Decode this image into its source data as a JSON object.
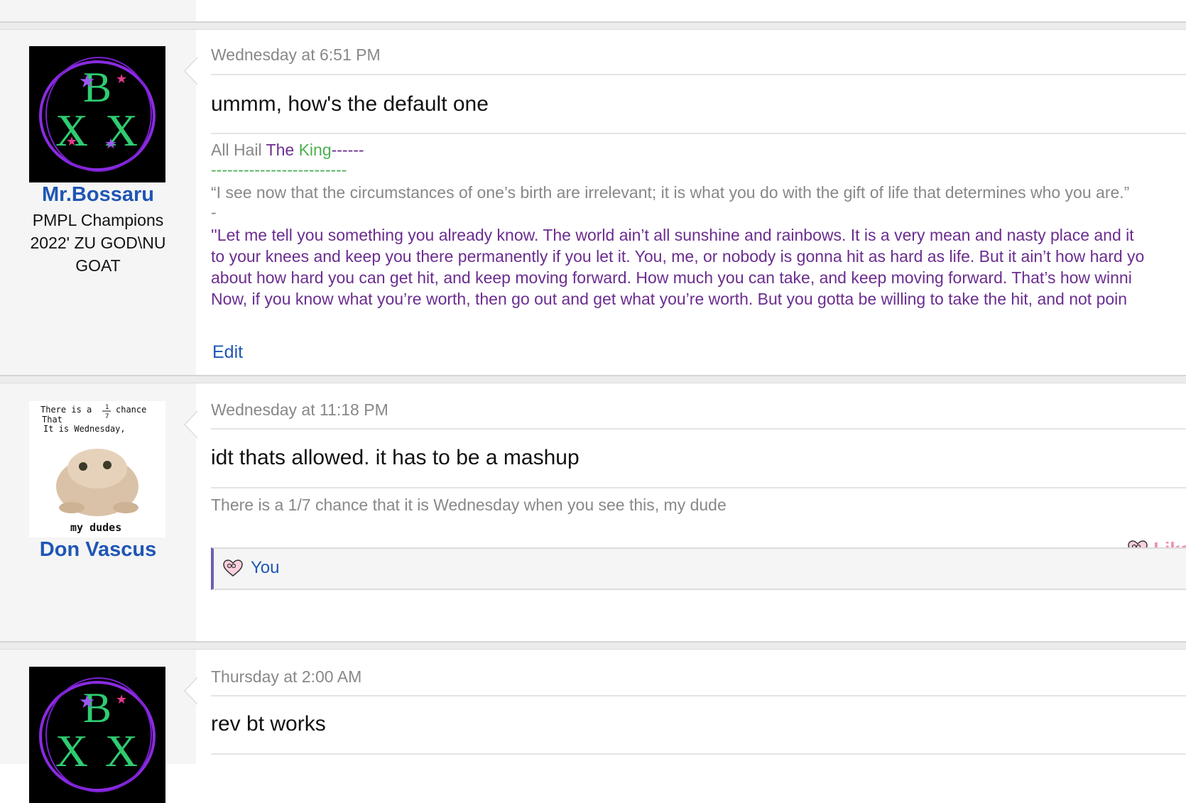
{
  "top_partial_text": "Mr.Bossaru",
  "posts": [
    {
      "author": "Mr.Bossaru",
      "user_title": "PMPL Champions 2022' ZU GOD\\NU GOAT",
      "avatar_icon": "bx-logo-avatar",
      "date": "Wednesday at 6:51 PM",
      "message": "ummm, how's the default one",
      "signature": {
        "hail_prefix": "All Hail ",
        "hail_the": "The",
        "hail_king": " King",
        "hail_dashes": "------",
        "dash_line": "-------------------------",
        "quote1": "“I see now that the circumstances of one’s birth are irrelevant; it is what you do with the gift of life that determines who you are.”",
        "quote1_dash": "-",
        "quote2_line1": "''Let me tell you something you already know. The world ain’t all sunshine and rainbows. It is a very mean and nasty place and it",
        "quote2_line2": "to your knees and keep you there permanently if you let it. You, me, or nobody is gonna hit as hard as life. But it ain’t how hard yo",
        "quote2_line3": "about how hard you can get hit, and keep moving forward. How much you can take, and keep moving forward. That’s how winni",
        "quote2_line4": "Now, if you know what you’re worth, then go out and get what you’re worth. But you gotta be willing to take the hit, and not poin"
      },
      "action_edit": "Edit"
    },
    {
      "author": "Don Vascus",
      "avatar_icon": "wednesday-frog-avatar",
      "avatar_text_line1": "There is a",
      "avatar_fraction_num": "1",
      "avatar_fraction_den": "7",
      "avatar_text_chance": "chance",
      "avatar_text_line2": "That",
      "avatar_text_line3": "It is Wednesday,",
      "avatar_text_bottom": "my dudes",
      "date": "Wednesday at 11:18 PM",
      "message": "idt thats allowed. it has to be a mashup",
      "signature_text": "There is a 1/7 chance that it is Wednesday when you see this, my dude",
      "like_label": "Like",
      "likes_text": "You"
    },
    {
      "avatar_icon": "bx-logo-avatar",
      "date": "Thursday at 2:00 AM",
      "message": "rev bt works"
    }
  ],
  "colors": {
    "username": "#1f56b5",
    "signature_purple": "#6b2d8f",
    "signature_green": "#4caf50",
    "like_pink": "#f08cb4",
    "likes_bar_accent": "#6a5fb0"
  }
}
